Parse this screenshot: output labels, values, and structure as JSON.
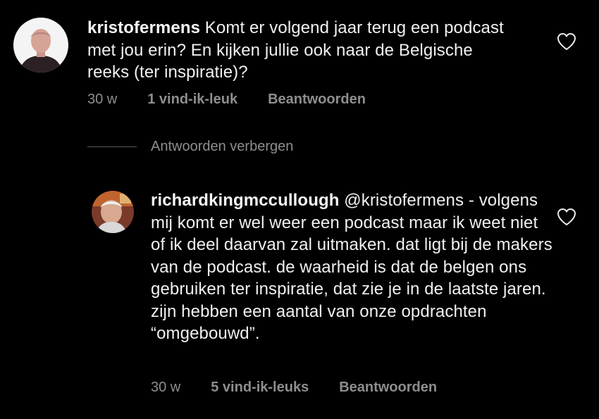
{
  "comments": [
    {
      "username": "kristofermens",
      "text": " Komt er volgend jaar terug een podcast met jou erin? En kijken jullie ook naar de Belgische reeks (ter inspiratie)?",
      "time": "30 w",
      "likes": "1 vind-ik-leuk",
      "reply": "Beantwoorden"
    }
  ],
  "hide_replies_label": "Antwoorden verbergen",
  "replies": [
    {
      "username": "richardkingmccullough",
      "mention": "@kristofermens",
      "text": " - volgens mij komt er wel weer een podcast maar ik weet niet of ik deel daarvan zal uitmaken. dat ligt bij de makers van de podcast. de waarheid is dat de belgen ons gebruiken ter inspiratie, dat zie je in de laatste jaren. zijn hebben een aantal van onze opdrachten “omgebouwd”.",
      "time": "30 w",
      "likes": "5 vind-ik-leuks",
      "reply": "Beantwoorden"
    }
  ],
  "icons": {
    "like": "heart-outline-icon"
  },
  "colors": {
    "background": "#000000",
    "text": "#f0f0f0",
    "meta": "#8e8e8e"
  }
}
